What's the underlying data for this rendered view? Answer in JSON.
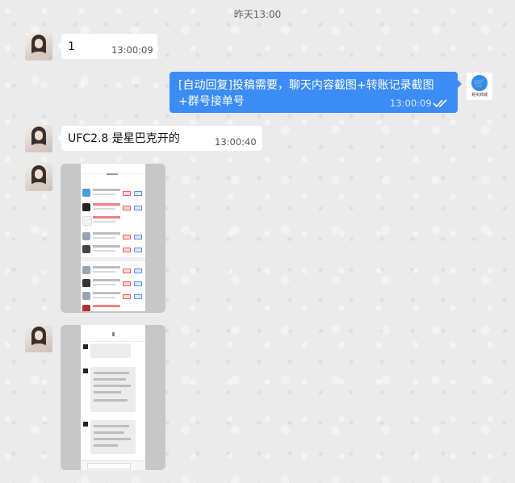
{
  "chat": {
    "time_label": "昨天13:00",
    "messages": [
      {
        "side": "left",
        "text": "1",
        "time": "13:00:09"
      },
      {
        "side": "right",
        "text_line1": "[自动回复]投稿需要，聊天内容截图+转账记录截图",
        "text_line2": "+群号接单号",
        "time": "13:00:09"
      },
      {
        "side": "left",
        "text": "UFC2.8 是星巴克开的",
        "time": "13:00:40"
      },
      {
        "side": "left",
        "type": "image"
      },
      {
        "side": "left",
        "type": "image"
      }
    ]
  },
  "shop_avatar": {
    "caption": "易买商城",
    "icon": "shopping-cart-icon"
  },
  "read_status_icon": "double-check-icon",
  "colors": {
    "outgoing_bubble": "#3b8cf5",
    "incoming_bubble": "#ffffff"
  }
}
